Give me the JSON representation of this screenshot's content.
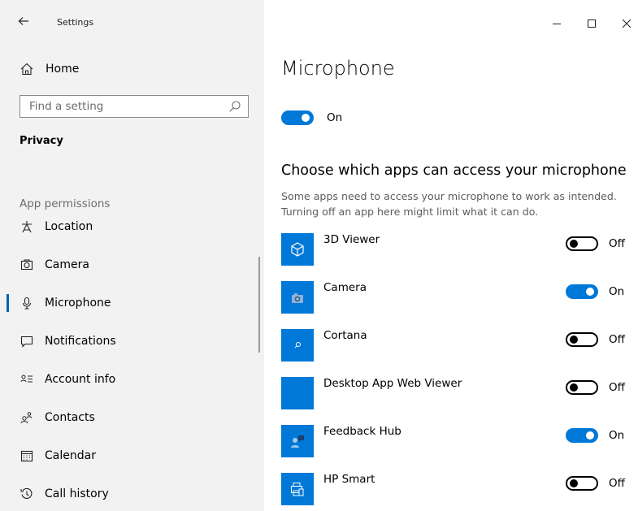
{
  "window": {
    "title": "Settings",
    "controls": [
      "minimize",
      "maximize",
      "close"
    ]
  },
  "sidebar": {
    "home_label": "Home",
    "search_placeholder": "Find a setting",
    "section_title": "Privacy",
    "group_label": "App permissions",
    "items": [
      {
        "label": "Location",
        "icon": "location-icon",
        "active": false
      },
      {
        "label": "Camera",
        "icon": "camera-icon",
        "active": false
      },
      {
        "label": "Microphone",
        "icon": "microphone-icon",
        "active": true
      },
      {
        "label": "Notifications",
        "icon": "notifications-icon",
        "active": false
      },
      {
        "label": "Account info",
        "icon": "account-info-icon",
        "active": false
      },
      {
        "label": "Contacts",
        "icon": "contacts-icon",
        "active": false
      },
      {
        "label": "Calendar",
        "icon": "calendar-icon",
        "active": false
      },
      {
        "label": "Call history",
        "icon": "call-history-icon",
        "active": false
      }
    ]
  },
  "main": {
    "title": "Microphone",
    "master_toggle": {
      "state": "On"
    },
    "subheading": "Choose which apps can access your microphone",
    "description": "Some apps need to access your microphone to work as intended. Turning off an app here might limit what it can do.",
    "apps": [
      {
        "name": "3D Viewer",
        "state": "Off",
        "icon": "3d-viewer-icon"
      },
      {
        "name": "Camera",
        "state": "On",
        "icon": "camera-app-icon"
      },
      {
        "name": "Cortana",
        "state": "Off",
        "icon": "cortana-icon"
      },
      {
        "name": "Desktop App Web Viewer",
        "state": "Off",
        "icon": "desktop-app-web-viewer-icon"
      },
      {
        "name": "Feedback Hub",
        "state": "On",
        "icon": "feedback-hub-icon"
      },
      {
        "name": "HP Smart",
        "state": "Off",
        "icon": "hp-smart-icon"
      }
    ]
  },
  "colors": {
    "accent": "#0078d7",
    "active_bar": "#0063b1",
    "sidebar_bg": "#f2f2f2"
  }
}
